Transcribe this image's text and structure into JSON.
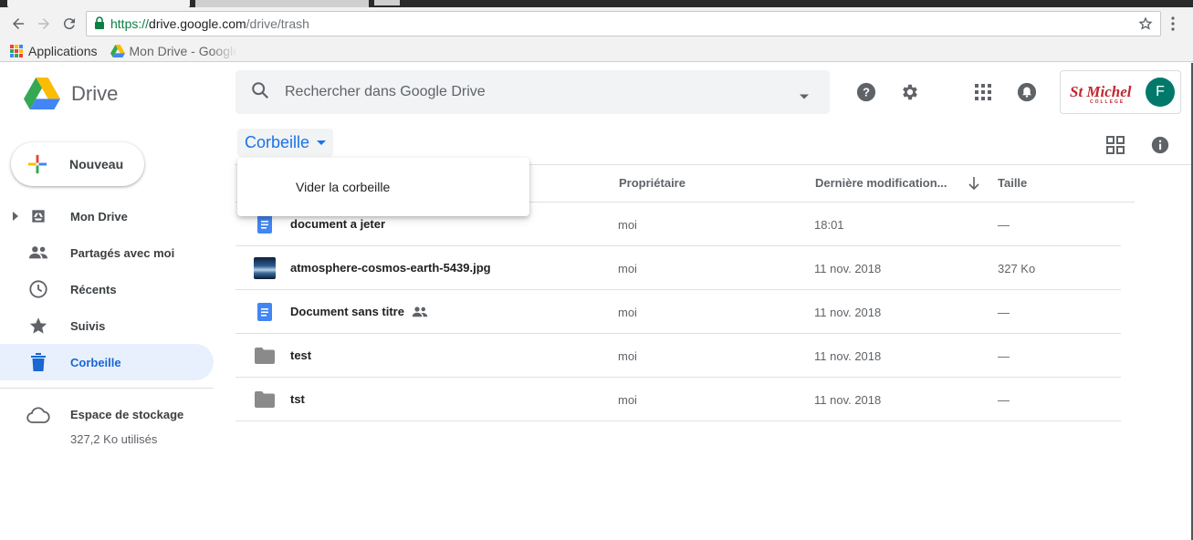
{
  "browser": {
    "url_secure": "https://",
    "url_host": "drive.google.com",
    "url_path": "/drive/trash",
    "bookmarks": [
      {
        "label": "Applications"
      },
      {
        "label": "Mon Drive - Google Drive"
      }
    ]
  },
  "header": {
    "app_name": "Drive",
    "search_placeholder": "Rechercher dans Google Drive",
    "brand_text": "St Michel",
    "brand_sub": "COLLEGE",
    "avatar_letter": "F"
  },
  "sidebar": {
    "new_label": "Nouveau",
    "items": [
      {
        "label": "Mon Drive",
        "icon": "drive-icon"
      },
      {
        "label": "Partagés avec moi",
        "icon": "people-icon"
      },
      {
        "label": "Récents",
        "icon": "clock-icon"
      },
      {
        "label": "Suivis",
        "icon": "star-icon"
      },
      {
        "label": "Corbeille",
        "icon": "trash-icon",
        "active": true
      }
    ],
    "storage_label": "Espace de stockage",
    "storage_used": "327,2 Ko utilisés"
  },
  "main": {
    "breadcrumb": "Corbeille",
    "menu_item": "Vider la corbeille",
    "columns": {
      "owner": "Propriétaire",
      "modified": "Dernière modification...",
      "size": "Taille"
    },
    "files": [
      {
        "name": "document a jeter",
        "type": "doc",
        "owner": "moi",
        "modified": "18:01",
        "size": "—"
      },
      {
        "name": "atmosphere-cosmos-earth-5439.jpg",
        "type": "image",
        "owner": "moi",
        "modified": "11 nov. 2018",
        "size": "327 Ko"
      },
      {
        "name": "Document sans titre",
        "type": "doc-shared",
        "owner": "moi",
        "modified": "11 nov. 2018",
        "size": "—"
      },
      {
        "name": "test",
        "type": "folder",
        "owner": "moi",
        "modified": "11 nov. 2018",
        "size": "—"
      },
      {
        "name": "tst",
        "type": "folder",
        "owner": "moi",
        "modified": "11 nov. 2018",
        "size": "—"
      }
    ]
  },
  "colors": {
    "accent_blue": "#1a73e8",
    "active_bg": "#e8f0fe",
    "avatar_bg": "#00796b",
    "brand_red": "#c0282d"
  }
}
